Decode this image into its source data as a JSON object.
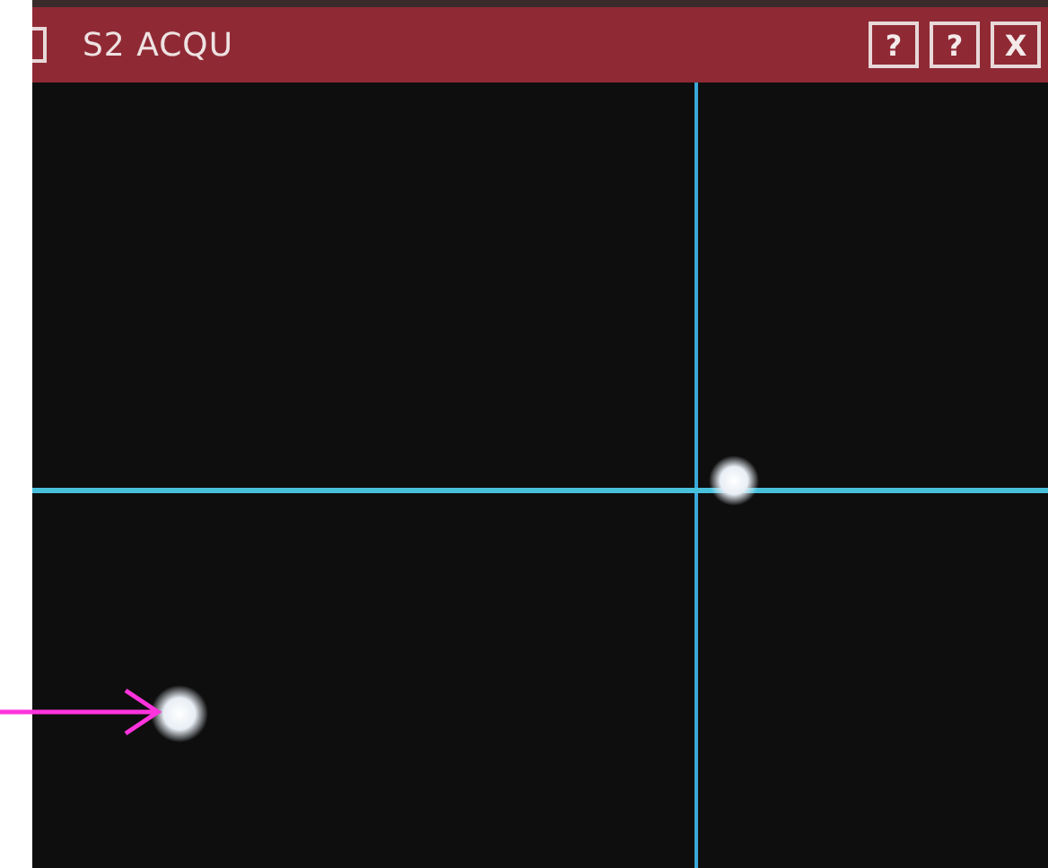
{
  "window": {
    "title": "S2 ACQU",
    "buttons": [
      {
        "label": "?"
      },
      {
        "label": "?"
      },
      {
        "label": "X"
      }
    ]
  }
}
